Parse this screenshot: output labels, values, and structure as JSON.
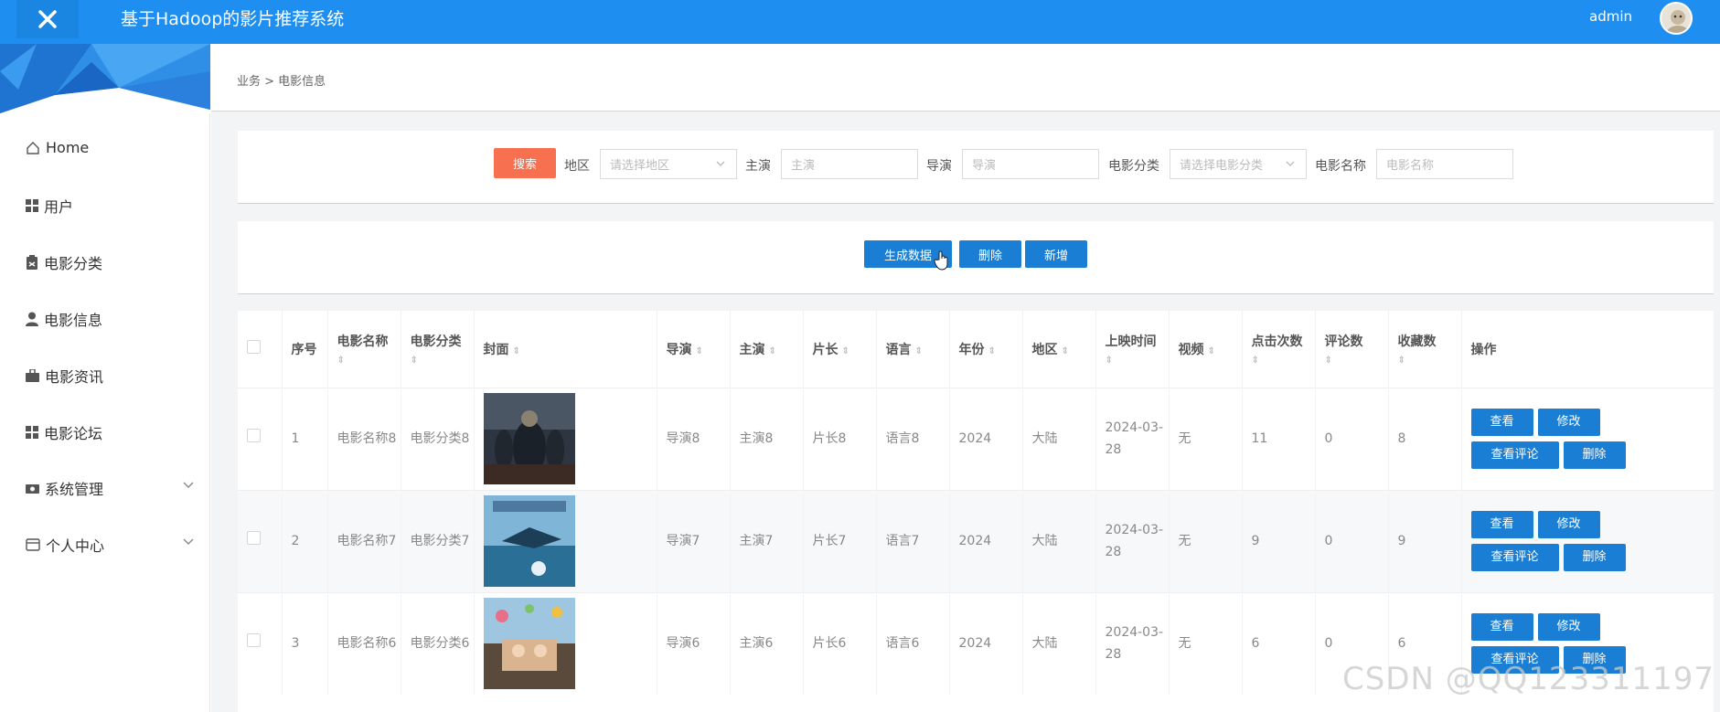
{
  "header": {
    "title": "基于Hadoop的影片推荐系统",
    "user": "admin",
    "brand_color": "#1e8ff0"
  },
  "sidebar": {
    "items": [
      {
        "label": "Home",
        "icon": "home-icon"
      },
      {
        "label": "用户",
        "icon": "grid-icon"
      },
      {
        "label": "电影分类",
        "icon": "clipboard-icon"
      },
      {
        "label": "电影信息",
        "icon": "person-icon"
      },
      {
        "label": "电影资讯",
        "icon": "briefcase-icon"
      },
      {
        "label": "电影论坛",
        "icon": "grid-icon"
      },
      {
        "label": "系统管理",
        "icon": "camera-icon"
      },
      {
        "label": "个人中心",
        "icon": "card-icon"
      }
    ]
  },
  "breadcrumb": "业务 > 电影信息",
  "search": {
    "button": "搜索",
    "region_label": "地区",
    "region_placeholder": "请选择地区",
    "actor_label": "主演",
    "actor_placeholder": "主演",
    "director_label": "导演",
    "director_placeholder": "导演",
    "category_label": "电影分类",
    "category_placeholder": "请选择电影分类",
    "name_label": "电影名称",
    "name_placeholder": "电影名称"
  },
  "actions": {
    "generate": "生成数据",
    "delete": "删除",
    "add": "新增"
  },
  "table": {
    "headers": [
      "序号",
      "电影名称",
      "电影分类",
      "封面",
      "导演",
      "主演",
      "片长",
      "语言",
      "年份",
      "地区",
      "上映时间",
      "视频",
      "点击次数",
      "评论数",
      "收藏数",
      "操作"
    ],
    "rows": [
      {
        "no": "1",
        "name": "电影名称8",
        "category": "电影分类8",
        "director": "导演8",
        "actor": "主演8",
        "length": "片长8",
        "language": "语言8",
        "year": "2024",
        "region": "大陆",
        "release": "2024-03-28",
        "video": "无",
        "clicks": "11",
        "comments": "0",
        "favorites": "8"
      },
      {
        "no": "2",
        "name": "电影名称7",
        "category": "电影分类7",
        "director": "导演7",
        "actor": "主演7",
        "length": "片长7",
        "language": "语言7",
        "year": "2024",
        "region": "大陆",
        "release": "2024-03-28",
        "video": "无",
        "clicks": "9",
        "comments": "0",
        "favorites": "9"
      },
      {
        "no": "3",
        "name": "电影名称6",
        "category": "电影分类6",
        "director": "导演6",
        "actor": "主演6",
        "length": "片长6",
        "language": "语言6",
        "year": "2024",
        "region": "大陆",
        "release": "2024-03-28",
        "video": "无",
        "clicks": "6",
        "comments": "0",
        "favorites": "6"
      }
    ],
    "row_ops": {
      "view": "查看",
      "edit": "修改",
      "view_comments": "查看评论",
      "delete": "删除"
    }
  },
  "watermark": "CSDN @QQ123311197"
}
